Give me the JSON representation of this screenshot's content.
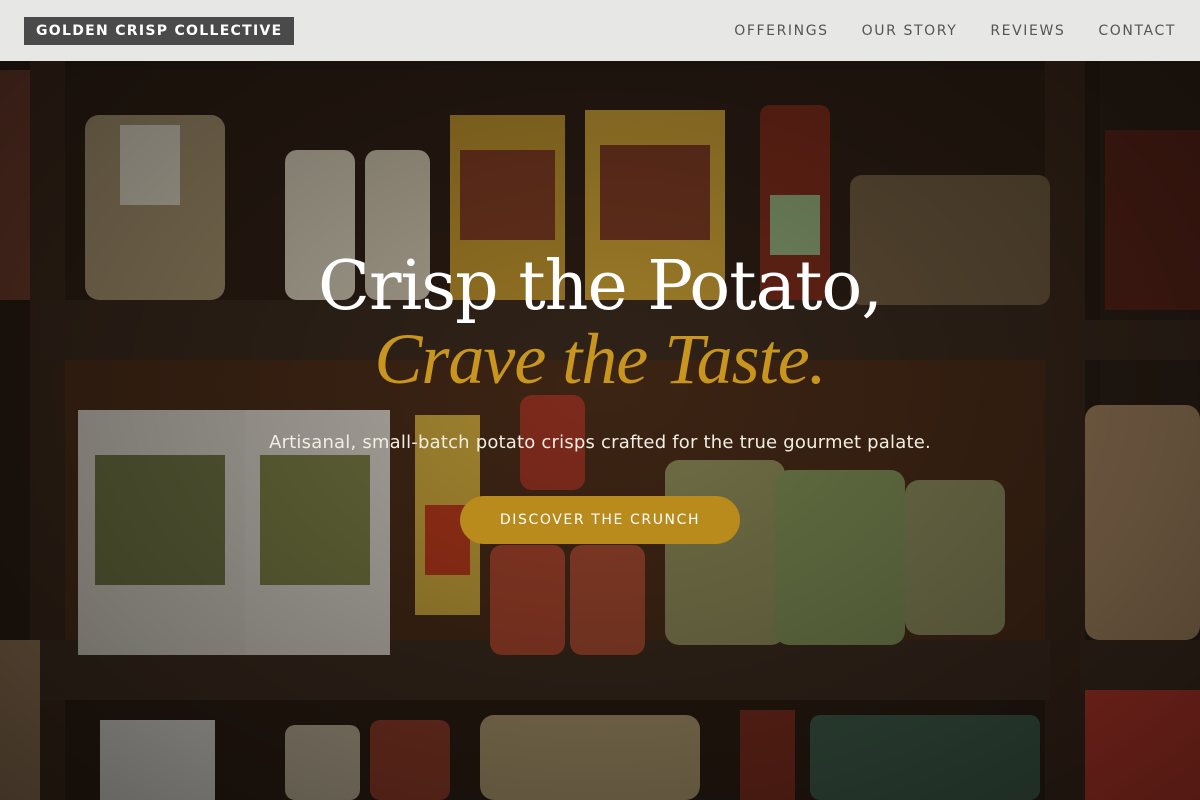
{
  "brand": {
    "name": "GOLDEN CRISP COLLECTIVE"
  },
  "nav": {
    "items": [
      {
        "label": "OFFERINGS"
      },
      {
        "label": "OUR STORY"
      },
      {
        "label": "REVIEWS"
      },
      {
        "label": "CONTACT"
      }
    ]
  },
  "hero": {
    "headline_line1": "Crisp the Potato,",
    "headline_line2": "Crave the Taste.",
    "tagline": "Artisanal, small-batch potato crisps crafted for the true gourmet palate.",
    "cta_label": "DISCOVER THE CRUNCH",
    "background": "pantry-shelves-photo"
  },
  "colors": {
    "accent": "#c8951f",
    "button": "#b98a1c",
    "header_bg": "#f0f0ee",
    "brand_bg": "#4a4a4a"
  }
}
